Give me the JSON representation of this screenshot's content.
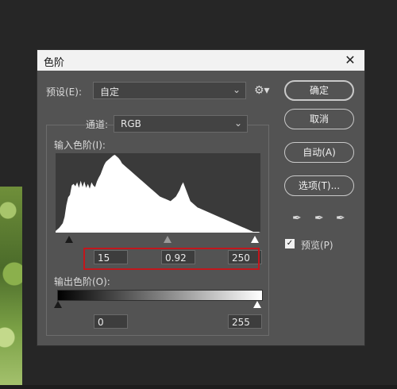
{
  "dialog": {
    "title": "色阶",
    "close_glyph": "✕",
    "preset": {
      "label": "预设(E):",
      "value": "自定"
    },
    "channel": {
      "label": "通道:",
      "value": "RGB"
    },
    "input_levels": {
      "label": "输入色阶(I):",
      "black": "15",
      "gamma": "0.92",
      "white": "250"
    },
    "output_levels": {
      "label": "输出色阶(O):",
      "black": "0",
      "white": "255"
    },
    "buttons": {
      "ok": "确定",
      "cancel": "取消",
      "auto": "自动(A)",
      "options": "选项(T)..."
    },
    "preview": {
      "label": "预览(P)",
      "checked": true
    },
    "icons": {
      "gear": "gear-icon",
      "chevron": "chevron-down-icon",
      "eyedropper_black": "eyedropper-black-icon",
      "eyedropper_gray": "eyedropper-gray-icon",
      "eyedropper_white": "eyedropper-white-icon"
    }
  },
  "histogram": {
    "values": [
      2,
      4,
      6,
      9,
      12,
      20,
      35,
      45,
      48,
      60,
      62,
      59,
      64,
      57,
      66,
      58,
      65,
      57,
      62,
      56,
      64,
      60,
      58,
      65,
      70,
      74,
      80,
      86,
      90,
      92,
      94,
      96,
      98,
      99,
      97,
      95,
      92,
      88,
      86,
      84,
      82,
      80,
      78,
      76,
      74,
      72,
      70,
      68,
      66,
      64,
      62,
      60,
      58,
      56,
      54,
      52,
      50,
      48,
      46,
      45,
      44,
      43,
      42,
      41,
      40,
      42,
      44,
      46,
      50,
      54,
      60,
      64,
      58,
      52,
      46,
      40,
      38,
      36,
      34,
      32,
      31,
      30,
      29,
      28,
      27,
      26,
      25,
      24,
      23,
      22,
      21,
      20,
      19,
      18,
      17,
      16,
      15,
      14,
      13,
      12,
      11,
      10,
      9,
      8,
      7,
      6,
      5,
      4,
      3,
      2,
      1,
      1,
      1,
      1,
      0
    ]
  }
}
